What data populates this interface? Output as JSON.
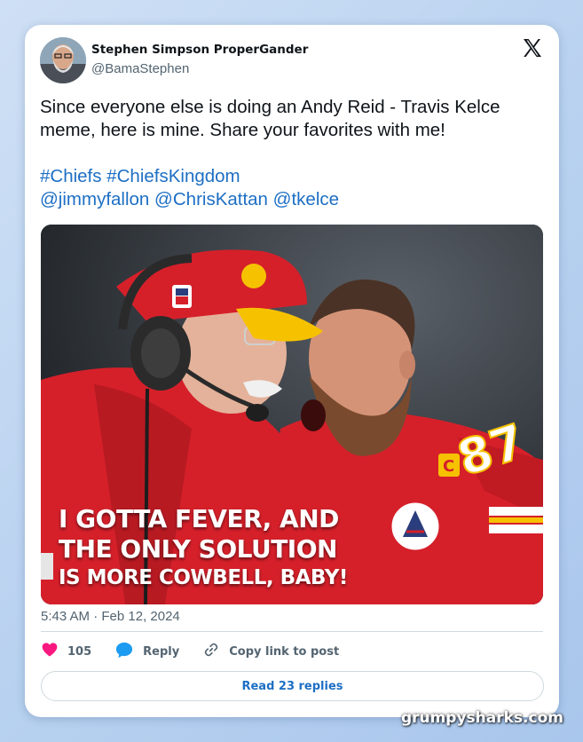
{
  "tweet": {
    "author": {
      "display_name": "Stephen Simpson ProperGander",
      "handle": "@BamaStephen"
    },
    "text_line1": "Since everyone else is doing an Andy Reid - Travis Kelce",
    "text_line2": "meme, here is mine. Share your favorites with me!",
    "hashtags": [
      "#Chiefs",
      "#ChiefsKingdom"
    ],
    "mentions": [
      "@jimmyfallon",
      "@ChrisKattan",
      "@tkelce"
    ],
    "media": {
      "caption_line1": "I GOTTA FEVER, AND",
      "caption_line2": "THE ONLY SOLUTION",
      "caption_line3": "IS MORE COWBELL, BABY!",
      "jersey_number": "87"
    },
    "timestamp": "5:43 AM · Feb 12, 2024",
    "actions": {
      "like_count": "105",
      "reply_label": "Reply",
      "copy_label": "Copy link to post"
    },
    "read_replies_label": "Read 23 replies"
  },
  "watermark": "grumpysharks.com",
  "colors": {
    "link": "#1d6fc4",
    "like": "#f91880",
    "reply_icon": "#1d9bf0",
    "chiefs_red": "#d5202a",
    "chiefs_gold": "#f6c200"
  },
  "icons": [
    "avatar",
    "x-logo-icon",
    "heart-icon",
    "reply-bubble-icon",
    "link-icon"
  ]
}
